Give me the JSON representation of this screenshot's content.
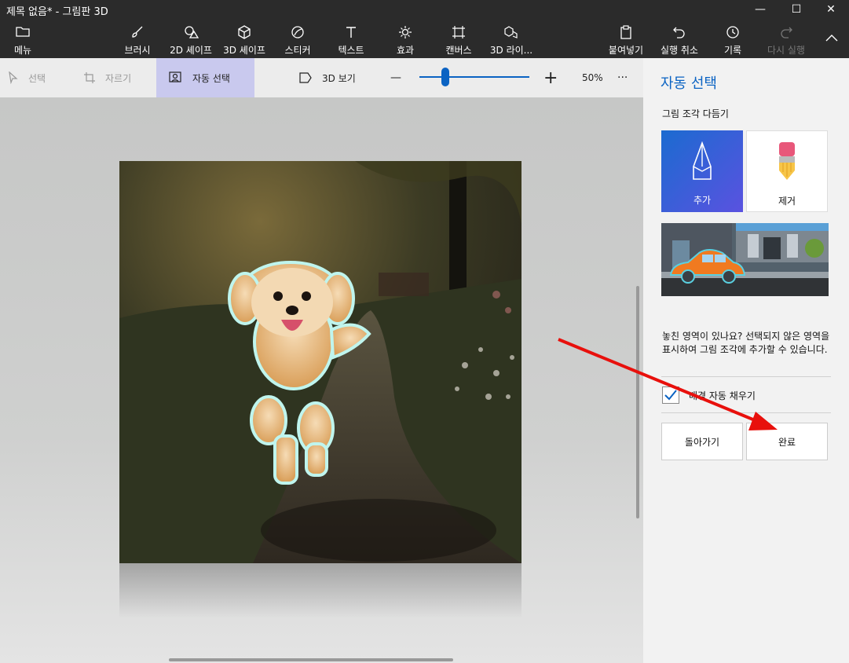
{
  "window": {
    "title": "제목 없음* - 그림판 3D",
    "minimize": "—",
    "maximize": "☐",
    "close": "✕"
  },
  "ribbon": {
    "menu": "메뉴",
    "brush": "브러시",
    "shapes2d": "2D 셰이프",
    "shapes3d": "3D 셰이프",
    "stickers": "스티커",
    "text": "텍스트",
    "effects": "효과",
    "canvas": "캔버스",
    "library3d": "3D 라이...",
    "paste": "붙여넣기",
    "undo": "실행 취소",
    "history": "기록",
    "redo": "다시 실행"
  },
  "toolbar": {
    "select": "선택",
    "crop": "자르기",
    "magic_select": "자동 선택",
    "view3d": "3D 보기",
    "zoom_minus": "—",
    "zoom_plus": "+",
    "zoom": "50%",
    "more": "···"
  },
  "panel": {
    "heading": "자동 선택",
    "refine_label": "그림 조각 다듬기",
    "add": "추가",
    "remove": "제거",
    "description": "놓친 영역이 있나요? 선택되지 않은 영역을 표시하여 그림 조각에 추가할 수 있습니다.",
    "autofill_label": "배경 자동 채우기",
    "autofill_checked": true,
    "back": "돌아가기",
    "done": "완료"
  },
  "colors": {
    "accent": "#0b63c3",
    "annotation": "#e8100c"
  }
}
